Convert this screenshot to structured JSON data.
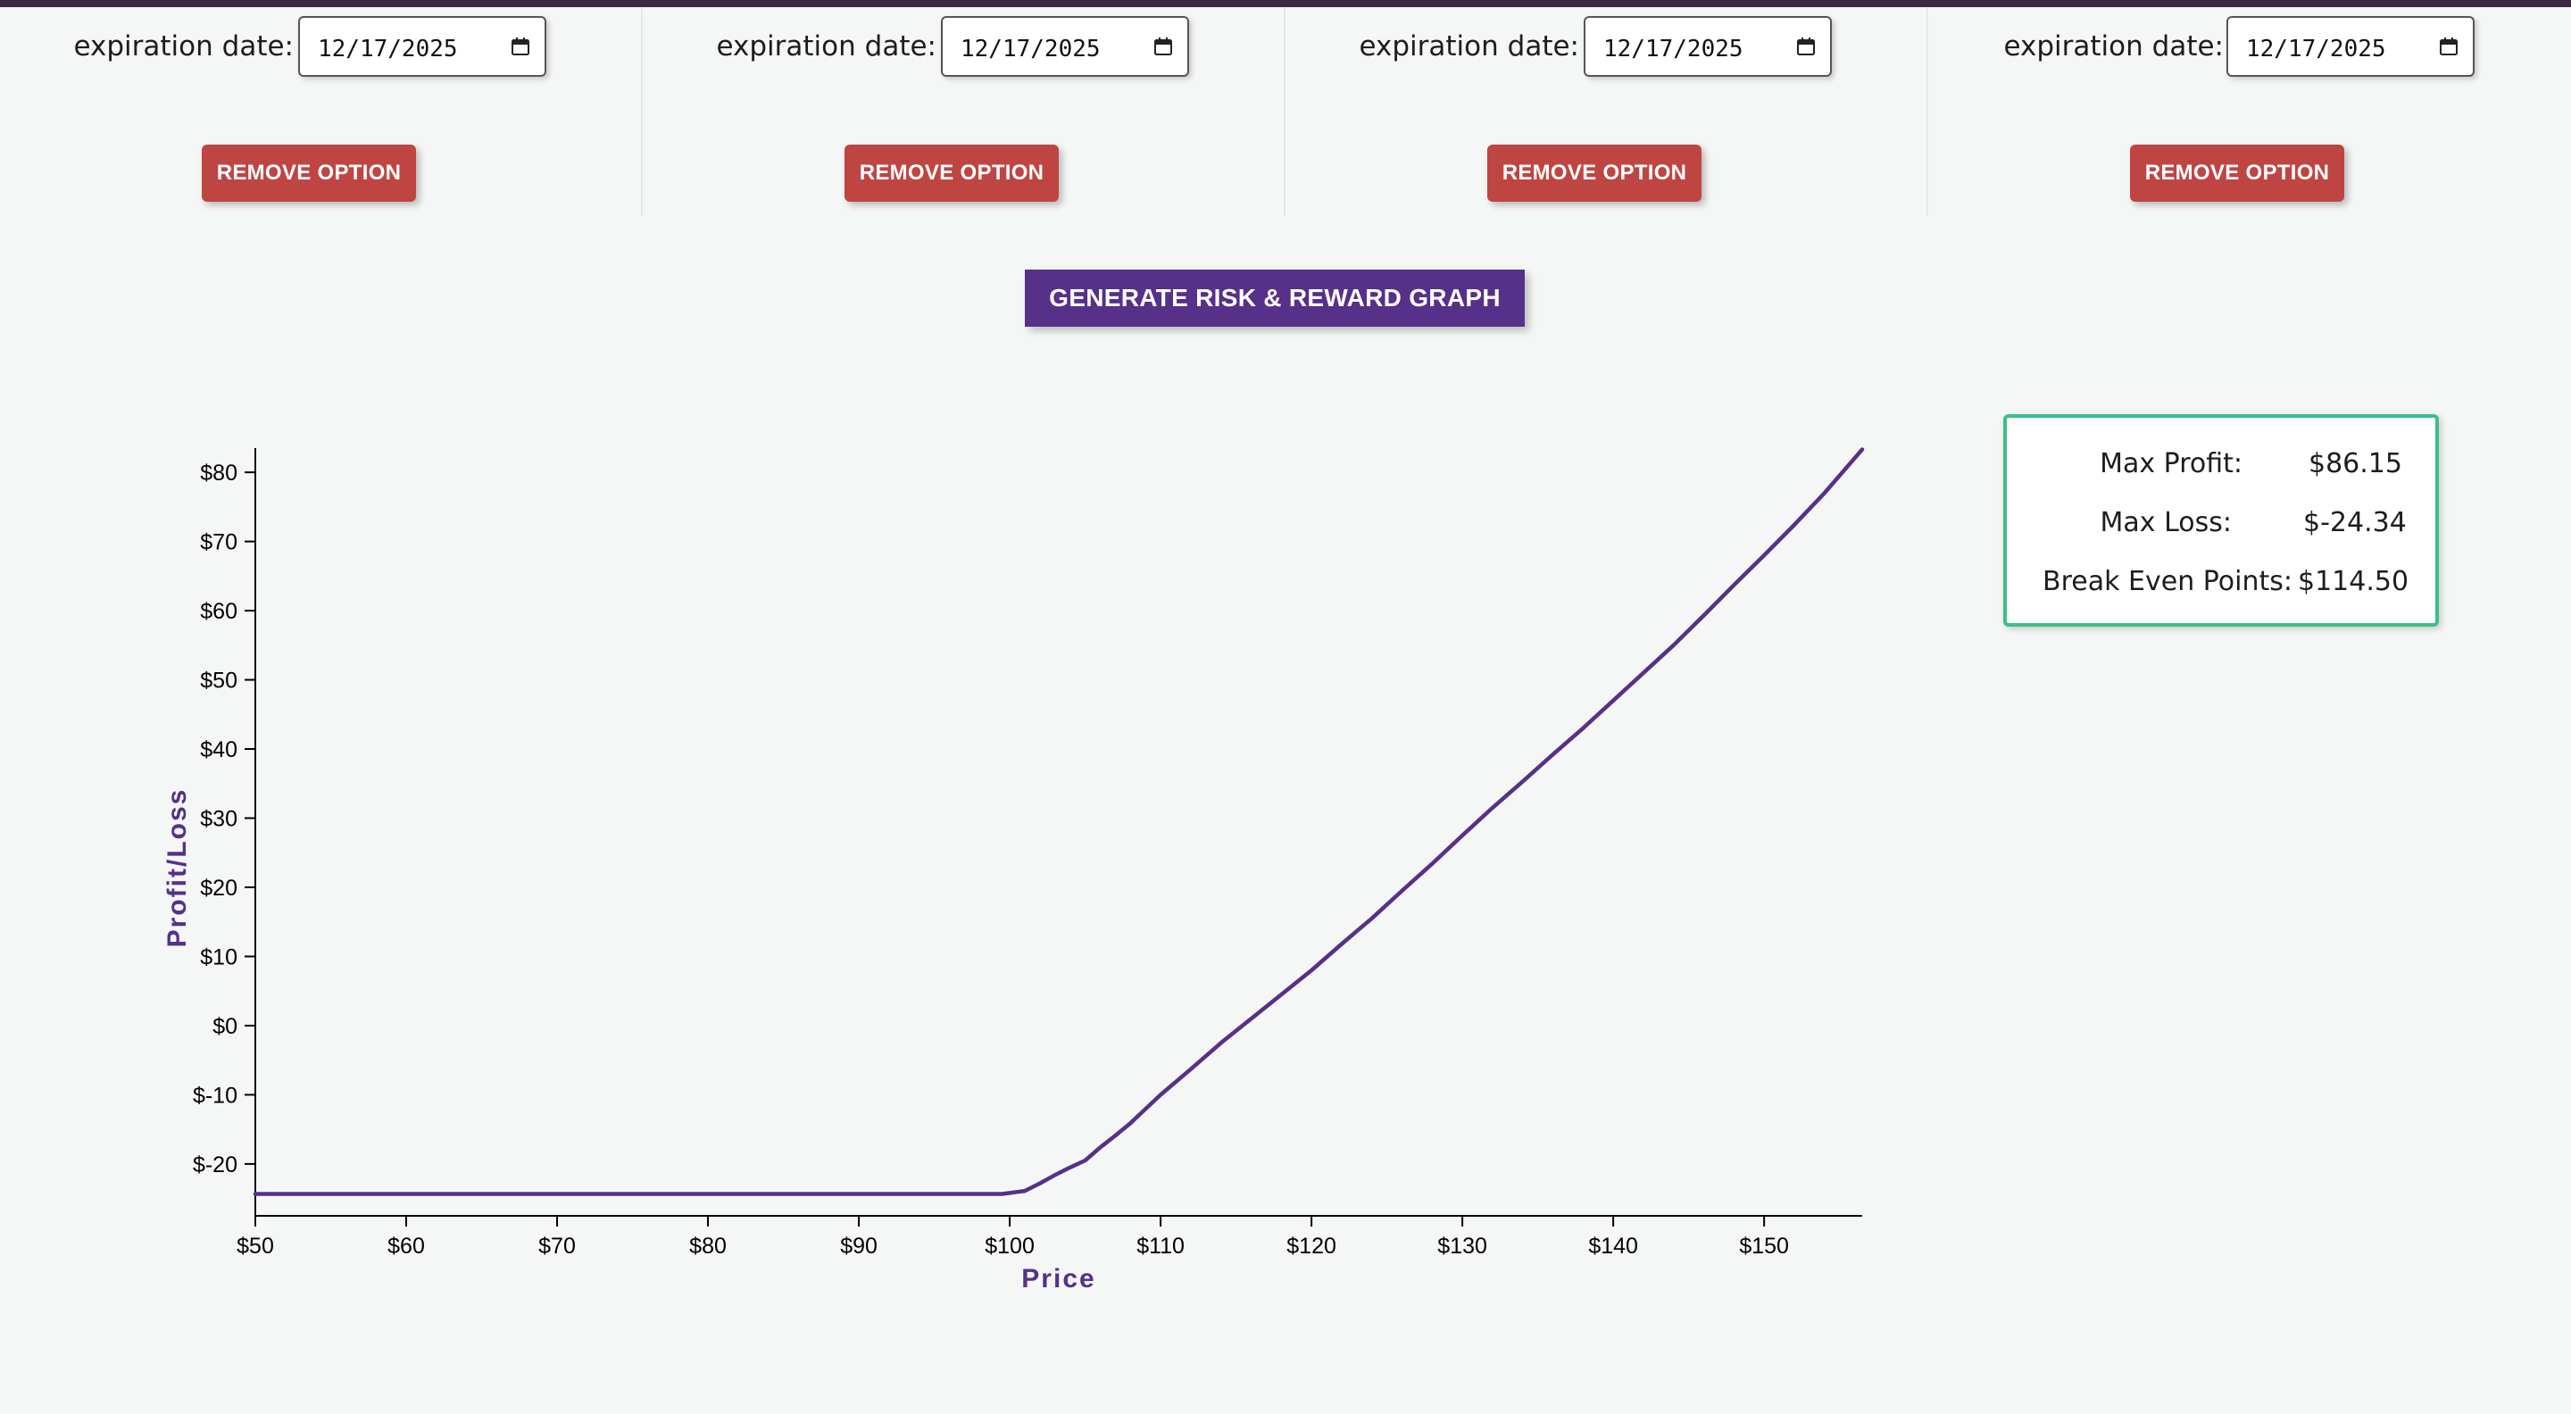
{
  "options": [
    {
      "expiration_label": "expiration date:",
      "expiration_value": "12/17/2025",
      "remove_label": "REMOVE OPTION"
    },
    {
      "expiration_label": "expiration date:",
      "expiration_value": "12/17/2025",
      "remove_label": "REMOVE OPTION"
    },
    {
      "expiration_label": "expiration date:",
      "expiration_value": "12/17/2025",
      "remove_label": "REMOVE OPTION"
    },
    {
      "expiration_label": "expiration date:",
      "expiration_value": "12/17/2025",
      "remove_label": "REMOVE OPTION"
    }
  ],
  "generate_button": {
    "label": "GENERATE RISK & REWARD GRAPH"
  },
  "stats": {
    "max_profit_label": "Max Profit:",
    "max_profit_value": "$86.15",
    "max_loss_label": "Max Loss:",
    "max_loss_value": "$-24.34",
    "break_even_label": "Break Even Points:",
    "break_even_value": "$114.50"
  },
  "colors": {
    "accent": "#563089",
    "danger": "#bf4542",
    "stats_border": "#3cbf8a",
    "line": "#563089"
  },
  "icons": {
    "date_picker": "calendar-icon"
  },
  "chart_data": {
    "type": "line",
    "xlabel": "Price",
    "ylabel": "Profit/Loss",
    "xlim": [
      50,
      156.5
    ],
    "ylim": [
      -27.5,
      83.5
    ],
    "xticks": [
      50,
      60,
      70,
      80,
      90,
      100,
      110,
      120,
      130,
      140,
      150
    ],
    "xtick_labels": [
      "$50",
      "$60",
      "$70",
      "$80",
      "$90",
      "$100",
      "$110",
      "$120",
      "$130",
      "$140",
      "$150"
    ],
    "yticks": [
      -20,
      -10,
      0,
      10,
      20,
      30,
      40,
      50,
      60,
      70,
      80
    ],
    "ytick_labels": [
      "$-20",
      "$-10",
      "$0",
      "$10",
      "$20",
      "$30",
      "$40",
      "$50",
      "$60",
      "$70",
      "$80"
    ],
    "series": [
      {
        "x": [
          50,
          60,
          70,
          80,
          90,
          99.5,
          101,
          102,
          103,
          104,
          105,
          106,
          107,
          108,
          110,
          112,
          114,
          116,
          118,
          120,
          122,
          124,
          126,
          128,
          130,
          132,
          134,
          136,
          138,
          140,
          142,
          144,
          146,
          148,
          150,
          152,
          154,
          156.5
        ],
        "y": [
          -24.34,
          -24.34,
          -24.34,
          -24.34,
          -24.34,
          -24.34,
          -23.9,
          -22.8,
          -21.6,
          -20.5,
          -19.5,
          -17.6,
          -15.9,
          -14.1,
          -10,
          -6.3,
          -2.5,
          1,
          4.5,
          8,
          11.8,
          15.5,
          19.5,
          23.4,
          27.5,
          31.5,
          35.3,
          39.2,
          43,
          47,
          51,
          55,
          59.3,
          63.7,
          68,
          72.4,
          77,
          83.3
        ]
      }
    ]
  }
}
